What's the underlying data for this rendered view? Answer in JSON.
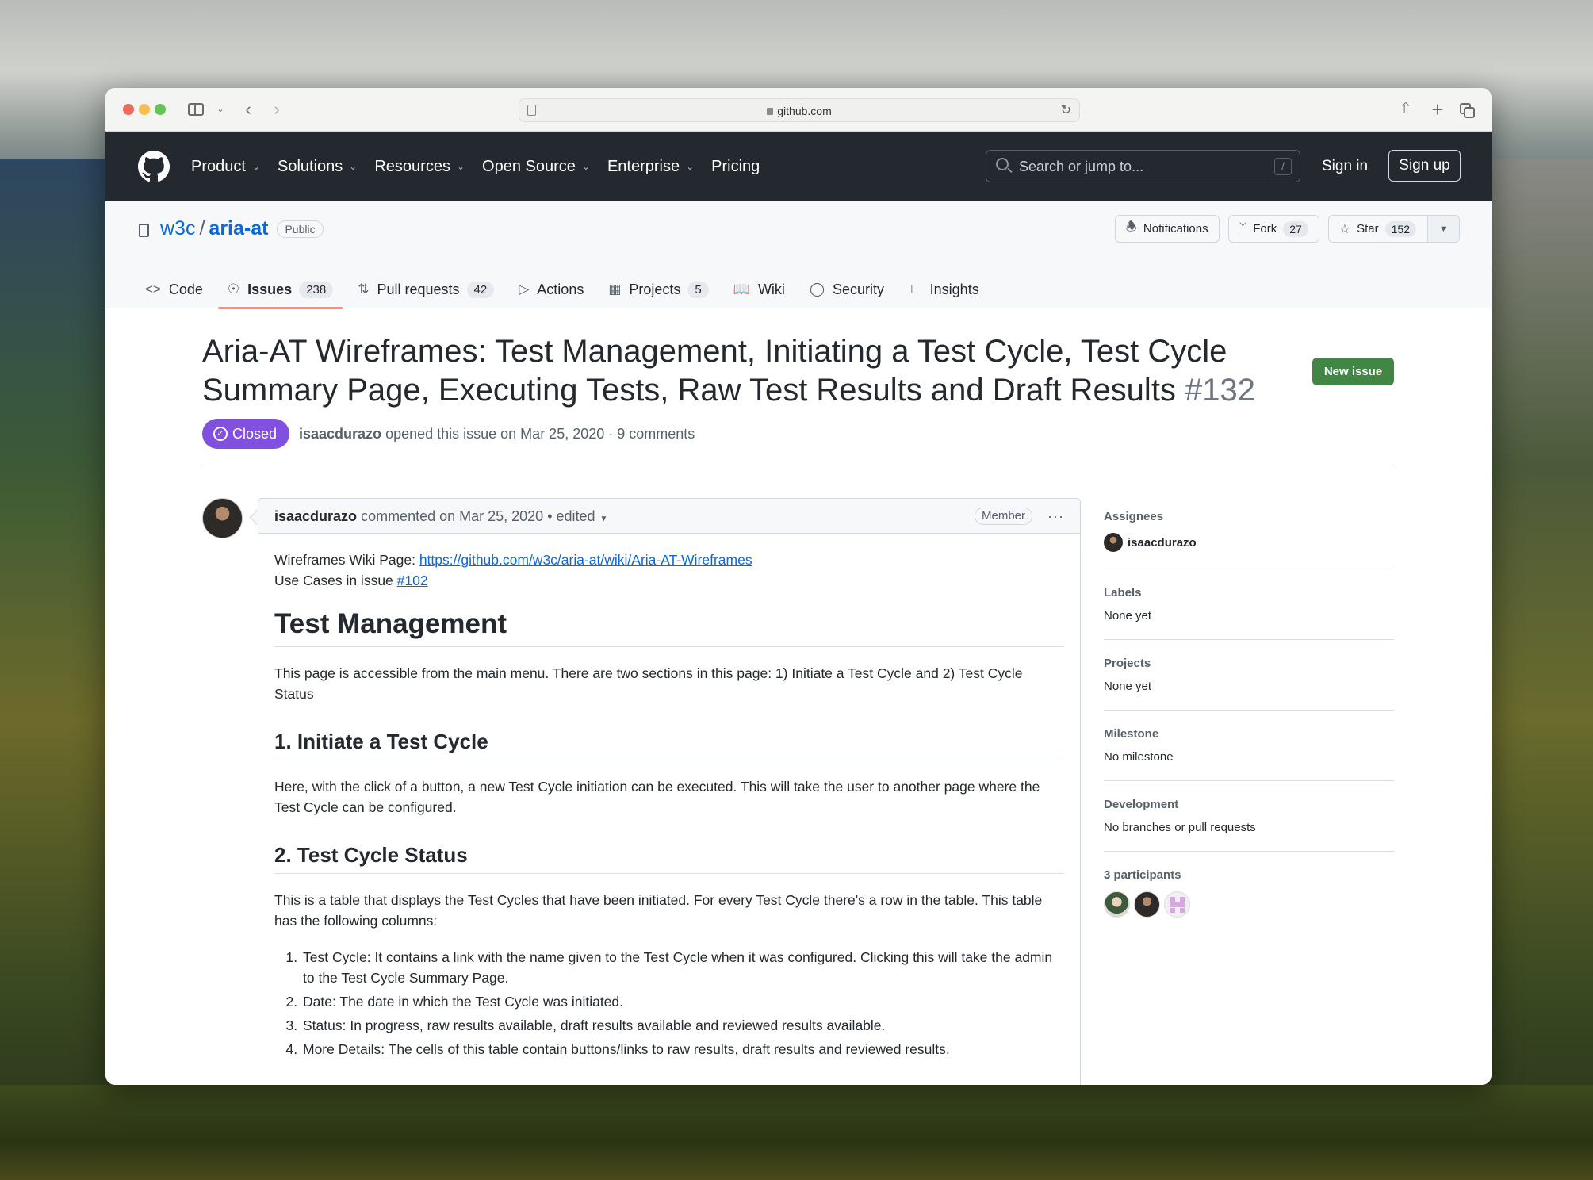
{
  "browser": {
    "url": "github.com"
  },
  "header": {
    "nav": [
      {
        "label": "Product",
        "dropdown": true
      },
      {
        "label": "Solutions",
        "dropdown": true
      },
      {
        "label": "Resources",
        "dropdown": true
      },
      {
        "label": "Open Source",
        "dropdown": true
      },
      {
        "label": "Enterprise",
        "dropdown": true
      },
      {
        "label": "Pricing",
        "dropdown": false
      }
    ],
    "search_placeholder": "Search or jump to...",
    "search_shortcut": "/",
    "sign_in": "Sign in",
    "sign_up": "Sign up"
  },
  "repo": {
    "owner": "w3c",
    "separator": "/",
    "name": "aria-at",
    "visibility": "Public",
    "actions": {
      "notifications": "Notifications",
      "fork": "Fork",
      "fork_count": "27",
      "star": "Star",
      "star_count": "152"
    },
    "tabs": [
      {
        "label": "Code",
        "icon": "code-icon",
        "count": null
      },
      {
        "label": "Issues",
        "icon": "issue-opened-icon",
        "count": "238",
        "active": true
      },
      {
        "label": "Pull requests",
        "icon": "git-pull-request-icon",
        "count": "42"
      },
      {
        "label": "Actions",
        "icon": "play-icon",
        "count": null
      },
      {
        "label": "Projects",
        "icon": "table-icon",
        "count": "5"
      },
      {
        "label": "Wiki",
        "icon": "book-icon",
        "count": null
      },
      {
        "label": "Security",
        "icon": "shield-icon",
        "count": null
      },
      {
        "label": "Insights",
        "icon": "graph-icon",
        "count": null
      }
    ]
  },
  "issue": {
    "title": "Aria-AT Wireframes: Test Management, Initiating a Test Cycle, Test Cycle Summary Page, Executing Tests, Raw Test Results and Draft Results",
    "number": "#132",
    "new_issue": "New issue",
    "state": "Closed",
    "author": "isaacdurazo",
    "meta_text": "opened this issue on Mar 25, 2020 · 9 comments",
    "accent_state_color": "#8250df"
  },
  "comment": {
    "author": "isaacdurazo",
    "meta": "commented on Mar 25, 2020 • edited",
    "role": "Member",
    "more": "···",
    "line1_prefix": "Wireframes Wiki Page: ",
    "line1_link": "https://github.com/w3c/aria-at/wiki/Aria-AT-Wireframes",
    "line2_prefix": "Use Cases in issue ",
    "line2_link": "#102",
    "h1": "Test Management",
    "p1": "This page is accessible from the main menu. There are two sections in this page: 1) Initiate a Test Cycle and 2) Test Cycle Status",
    "h2a": "1. Initiate a Test Cycle",
    "p2": "Here, with the click of a button, a new Test Cycle initiation can be executed. This will take the user to another page where the Test Cycle can be configured.",
    "h2b": "2. Test Cycle Status",
    "p3": "This is a table that displays the Test Cycles that have been initiated. For every Test Cycle there's a row in the table. This table has the following columns:",
    "list": [
      "Test Cycle: It contains a link with the name given to the Test Cycle when it was configured. Clicking this will take the admin to the Test Cycle Summary Page.",
      "Date: The date in which the Test Cycle was initiated.",
      "Status: In progress, raw results available, draft results available and reviewed results available.",
      "More Details: The cells of this table contain buttons/links to raw results, draft results and reviewed results."
    ]
  },
  "sidebar": {
    "assignees_label": "Assignees",
    "assignee": "isaacdurazo",
    "labels_label": "Labels",
    "labels_value": "None yet",
    "projects_label": "Projects",
    "projects_value": "None yet",
    "milestone_label": "Milestone",
    "milestone_value": "No milestone",
    "development_label": "Development",
    "development_value": "No branches or pull requests",
    "participants_label": "3 participants"
  }
}
